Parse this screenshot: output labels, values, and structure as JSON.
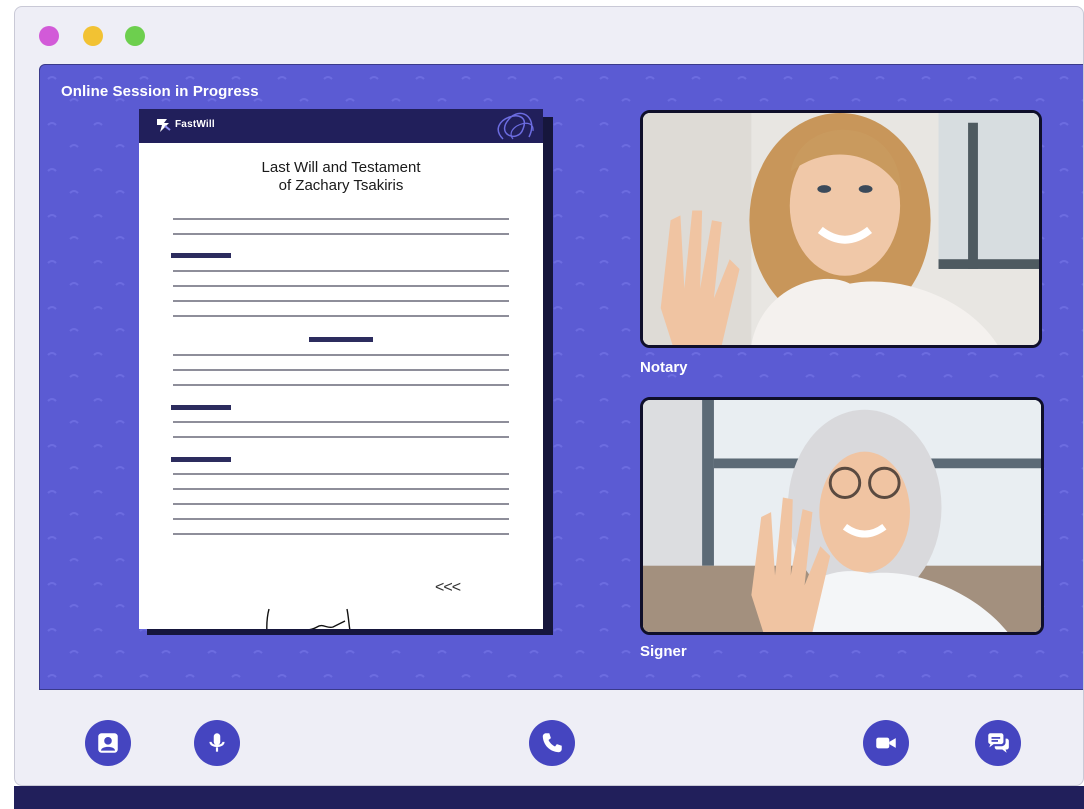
{
  "window": {
    "dots": [
      {
        "color": "#d25ad8"
      },
      {
        "color": "#f2c233"
      },
      {
        "color": "#6dcf4e"
      }
    ]
  },
  "session": {
    "title": "Online Session in Progress"
  },
  "document": {
    "logo_text": "FastWill",
    "title_line1": "Last Will and Testament",
    "title_line2": "of Zachary Tsakiris",
    "arrows_text": "<<<"
  },
  "participants": [
    {
      "label": "Notary"
    },
    {
      "label": "Signer"
    }
  ],
  "toolbar": {
    "buttons": [
      {
        "icon": "user-icon"
      },
      {
        "icon": "microphone-icon"
      },
      {
        "icon": "phone-icon"
      },
      {
        "icon": "video-camera-icon"
      },
      {
        "icon": "chat-icon"
      }
    ]
  },
  "colors": {
    "stage": "#5b5bd3",
    "accent": "#4545c0",
    "dark": "#211f5b"
  }
}
